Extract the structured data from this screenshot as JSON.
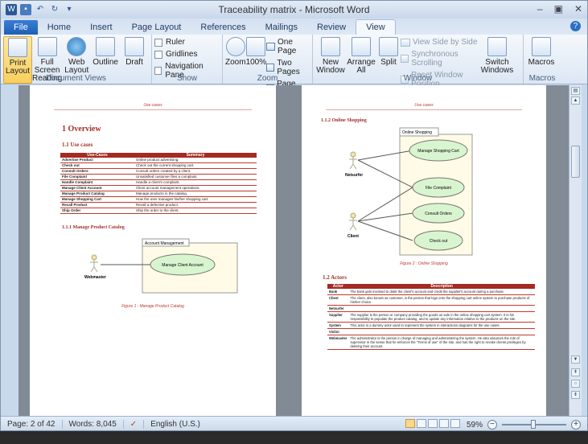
{
  "window": {
    "title": "Traceability matrix - Microsoft Word"
  },
  "tabs": [
    "File",
    "Home",
    "Insert",
    "Page Layout",
    "References",
    "Mailings",
    "Review",
    "View"
  ],
  "ribbon": {
    "document_views": {
      "label": "Document Views",
      "items": [
        "Print Layout",
        "Full Screen Reading",
        "Web Layout",
        "Outline",
        "Draft"
      ]
    },
    "show": {
      "label": "Show",
      "items": [
        "Ruler",
        "Gridlines",
        "Navigation Pane"
      ]
    },
    "zoom": {
      "label": "Zoom",
      "zoom": "Zoom",
      "pct": "100%",
      "one_page": "One Page",
      "two_pages": "Two Pages",
      "page_width": "Page Width"
    },
    "window": {
      "label": "Window",
      "new_window": "New Window",
      "arrange_all": "Arrange All",
      "split": "Split",
      "side_by_side": "View Side by Side",
      "sync_scroll": "Synchronous Scrolling",
      "reset_pos": "Reset Window Position",
      "switch": "Switch Windows"
    },
    "macros": {
      "label": "Macros",
      "macros": "Macros"
    }
  },
  "page1": {
    "header": "Use cases",
    "h1": "1  Overview",
    "h2": "1.1   Use cases",
    "table_headers": [
      "Use-Cases",
      "Summary"
    ],
    "rows": [
      [
        "Advertise Product",
        "Online product advertising."
      ],
      [
        "Check out",
        "Check out the current shopping cart."
      ],
      [
        "Consult Orders",
        "Consult orders created by a client."
      ],
      [
        "File Complaint",
        "Unsatisfied customer files a complaint."
      ],
      [
        "Handle Complaint",
        "Handle a client's complaint."
      ],
      [
        "Manage Client Account",
        "Client account management operations."
      ],
      [
        "Manage Product Catalog",
        "Manage products in the catalog."
      ],
      [
        "Manage Shopping Cart",
        "How the user manages his/her shopping cart."
      ],
      [
        "Recall Product",
        "Recall a defective product."
      ],
      [
        "Ship Order",
        "Ship the order to the client."
      ]
    ],
    "h3": "1.1.1  Manage Product Catalog",
    "diagram": {
      "system": "Account Management",
      "actor": "Webmaster",
      "usecase": "Manage Client Account"
    },
    "caption": "Figure 1 : Manage Product Catalog"
  },
  "page2": {
    "header": "Use cases",
    "h3": "1.1.2  Online Shopping",
    "diagram": {
      "system": "Online Shopping",
      "actors": [
        "Netsurfer",
        "Client"
      ],
      "usecases": [
        "Manage Shopping Cart",
        "File Complaint",
        "Consult Orders",
        "Check out"
      ]
    },
    "caption": "Figure 2 : Online Shopping",
    "h2": "1.2   Actors",
    "table_headers": [
      "Actor",
      "Description"
    ],
    "rows": [
      [
        "Bank",
        "The bank gets involved to debit the client's account and credit the supplier's account during a purchase."
      ],
      [
        "Client",
        "The client, also known as customer, is the person that logs onto the shopping cart online system to purchase products of his/her choice."
      ],
      [
        "Netsurfer",
        ""
      ],
      [
        "Supplier",
        "The supplier is the person or company providing the goods on sale in the online shopping cart system. It is his responsibility to populate the product catalog, and to update any information relative to the products on the site."
      ],
      [
        "System",
        "This actor is a dummy actor used to represent the system in interactions diagrams for the use cases."
      ],
      [
        "Visitor",
        ""
      ],
      [
        "Webmaster",
        "The administrator is the person in charge of managing and administering the system. He also assumes the role of supervisor in the sense that he enforces the \"Terms of use\" of the site, and has the right to revoke clients privileges by deleting their account."
      ]
    ]
  },
  "status": {
    "page": "Page: 2 of 42",
    "words": "Words: 8,045",
    "lang": "English (U.S.)",
    "zoom": "59%"
  }
}
